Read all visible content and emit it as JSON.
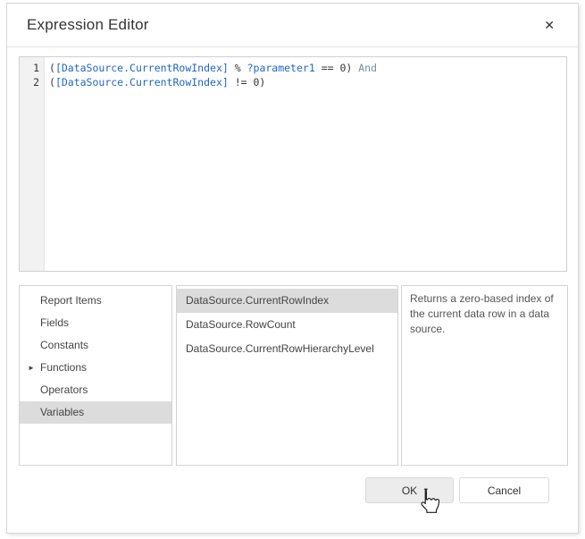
{
  "dialog": {
    "title": "Expression Editor",
    "close_glyph": "✕"
  },
  "editor": {
    "lines": [
      {
        "number": "1",
        "tokens": [
          {
            "text": "(",
            "type": "plain"
          },
          {
            "text": "[DataSource.CurrentRowIndex]",
            "type": "field"
          },
          {
            "text": " % ",
            "type": "plain"
          },
          {
            "text": "?parameter1",
            "type": "field"
          },
          {
            "text": " == 0) ",
            "type": "plain"
          },
          {
            "text": "And",
            "type": "keyword"
          }
        ]
      },
      {
        "number": "2",
        "tokens": [
          {
            "text": "(",
            "type": "plain"
          },
          {
            "text": "[DataSource.CurrentRowIndex]",
            "type": "field"
          },
          {
            "text": " != 0)",
            "type": "plain"
          }
        ]
      }
    ]
  },
  "categories": {
    "expand_arrow": "►",
    "items": [
      {
        "label": "Report Items"
      },
      {
        "label": "Fields"
      },
      {
        "label": "Constants"
      },
      {
        "label": "Functions"
      },
      {
        "label": "Operators"
      },
      {
        "label": "Variables"
      }
    ]
  },
  "members": {
    "items": [
      {
        "label": "DataSource.CurrentRowIndex"
      },
      {
        "label": "DataSource.RowCount"
      },
      {
        "label": "DataSource.CurrentRowHierarchyLevel"
      }
    ]
  },
  "description": {
    "text": "Returns a zero-based index of the current data row in a data source."
  },
  "footer": {
    "ok_label": "OK",
    "cancel_label": "Cancel"
  },
  "colors": {
    "selection_bg": "#dcdcdc",
    "code_field_blue": "#1f66c9",
    "code_keyword_gray": "#7d8ca3",
    "gutter_bg": "#f2f2f2",
    "border_gray": "#d6d6d6"
  }
}
